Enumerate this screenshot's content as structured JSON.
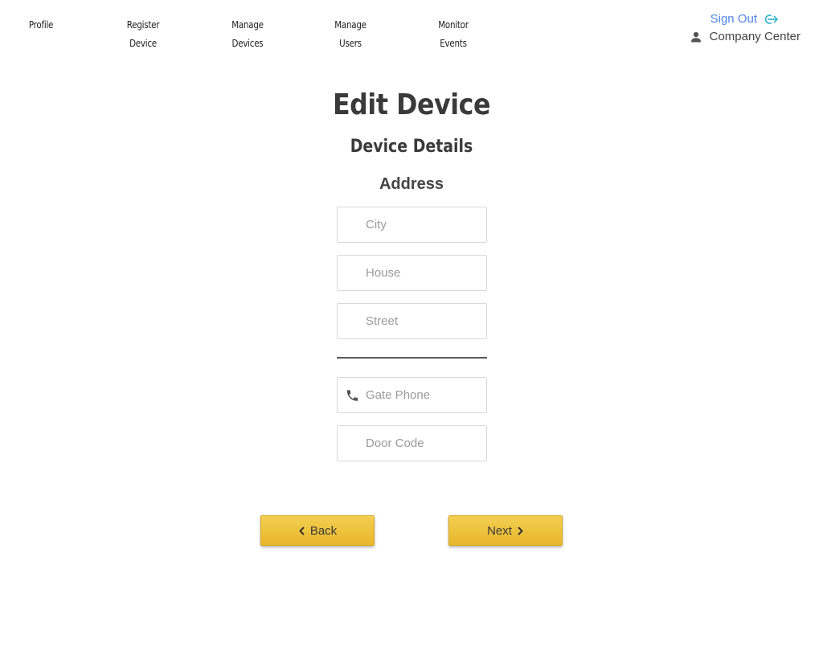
{
  "nav": {
    "items": [
      {
        "line1": "Profile",
        "line2": ""
      },
      {
        "line1": "Register",
        "line2": "Device"
      },
      {
        "line1": "Manage",
        "line2": "Devices"
      },
      {
        "line1": "Manage",
        "line2": "Users"
      },
      {
        "line1": "Monitor",
        "line2": "Events"
      }
    ]
  },
  "user": {
    "signout_label": "Sign Out",
    "signout_icon": "sign-out-icon",
    "company_name": "Company Center",
    "company_icon": "user-icon"
  },
  "page": {
    "title": "Edit Device",
    "subtitle": "Device Details",
    "section_title": "Address"
  },
  "form": {
    "city": {
      "placeholder": "City",
      "value": ""
    },
    "house": {
      "placeholder": "House",
      "value": ""
    },
    "street": {
      "placeholder": "Street",
      "value": ""
    },
    "gate_phone": {
      "placeholder": "Gate Phone",
      "value": "",
      "icon": "phone-icon"
    },
    "door_code": {
      "placeholder": "Door Code",
      "value": ""
    }
  },
  "actions": {
    "back_label": "Back",
    "next_label": "Next"
  },
  "colors": {
    "accent_link": "#4f86e8",
    "signout_icon": "#3fb6d3",
    "button_fill": "#ecbf35"
  }
}
